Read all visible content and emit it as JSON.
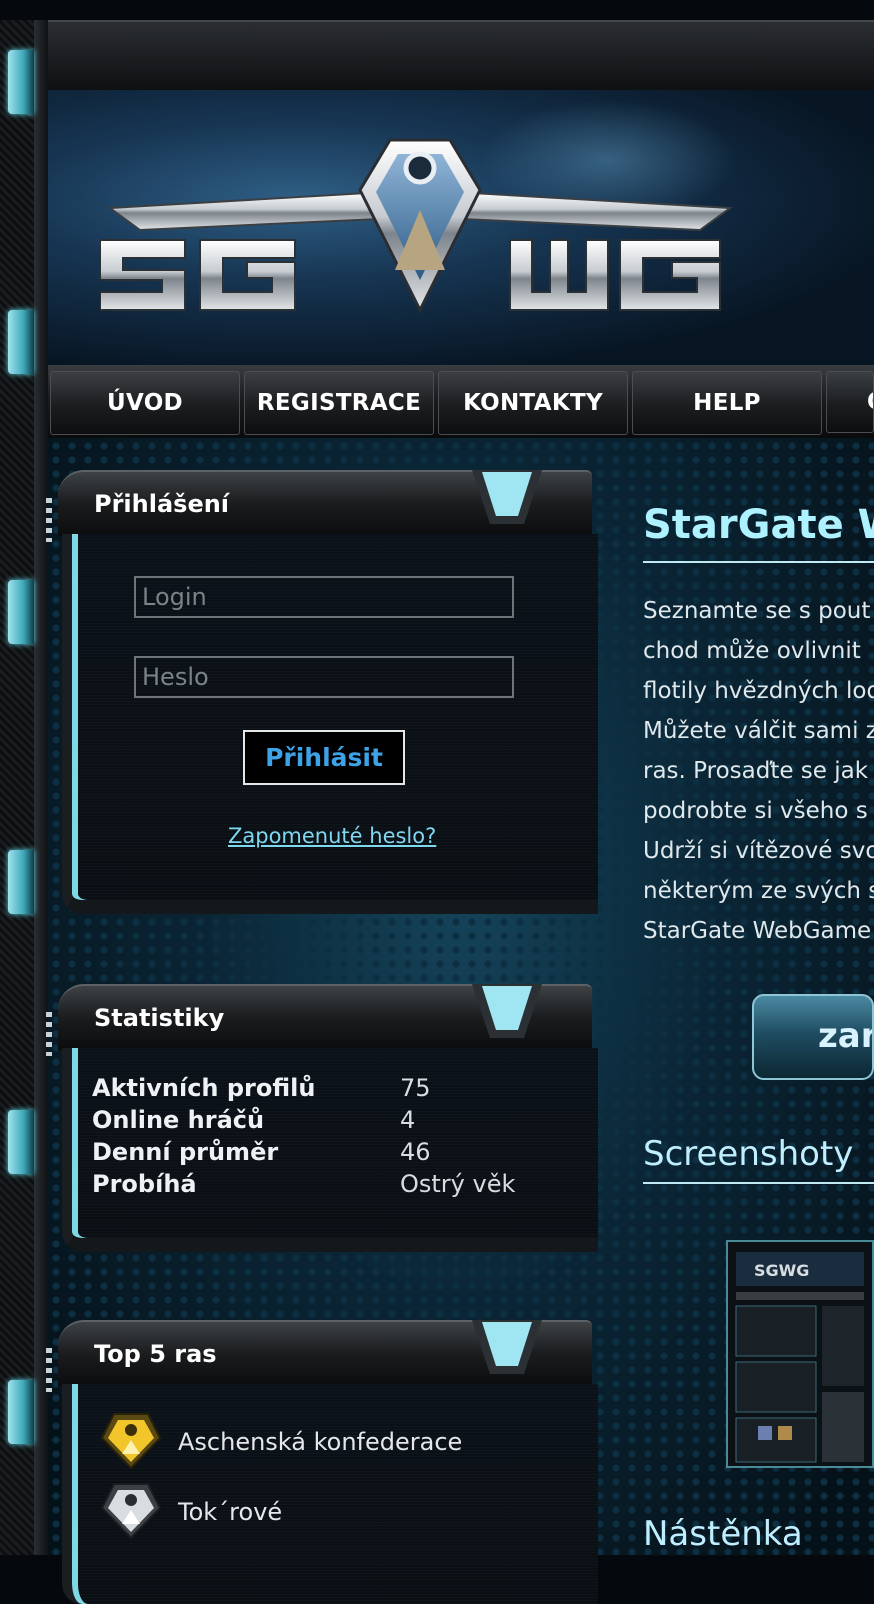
{
  "logo": {
    "text": "SGWG"
  },
  "nav": {
    "items": [
      {
        "label": "ÚVOD"
      },
      {
        "label": "REGISTRACE"
      },
      {
        "label": "KONTAKTY"
      },
      {
        "label": "HELP"
      },
      {
        "label": "O"
      }
    ]
  },
  "login_box": {
    "title": "Přihlášení",
    "login_placeholder": "Login",
    "password_placeholder": "Heslo",
    "submit_label": "Přihlásit",
    "forgot_link": "Zapomenuté heslo?"
  },
  "stats_box": {
    "title": "Statistiky",
    "rows": [
      {
        "label": "Aktivních profilů",
        "value": "75"
      },
      {
        "label": "Online hráčů",
        "value": "4"
      },
      {
        "label": "Denní průměr",
        "value": "46"
      },
      {
        "label": "Probíhá",
        "value": "Ostrý věk"
      }
    ]
  },
  "races_box": {
    "title": "Top 5 ras",
    "races": [
      {
        "name": "Aschenská konfederace",
        "icon": "gold-emblem-icon"
      },
      {
        "name": "Tok´rové",
        "icon": "silver-emblem-icon"
      }
    ]
  },
  "main": {
    "title": "StarGate W",
    "intro_lines": [
      "Seznamte se s pout",
      "chod může ovlivnit ",
      "flotily hvězdných lod",
      "Můžete válčit sami z",
      "ras. Prosaďte se jak",
      "podrobte si všeho s",
      "Udrží si vítězové svo",
      "některým ze svých s",
      "StarGate WebGame"
    ],
    "cta_label": "zar",
    "screenshots_title": "Screenshoty",
    "screenshot_logo": "SGWG",
    "board_title": "Nástěnka"
  },
  "colors": {
    "accent_cyan": "#aef2ff",
    "button_text_blue": "#3da3e6",
    "link_cyan": "#7fd8f0"
  }
}
